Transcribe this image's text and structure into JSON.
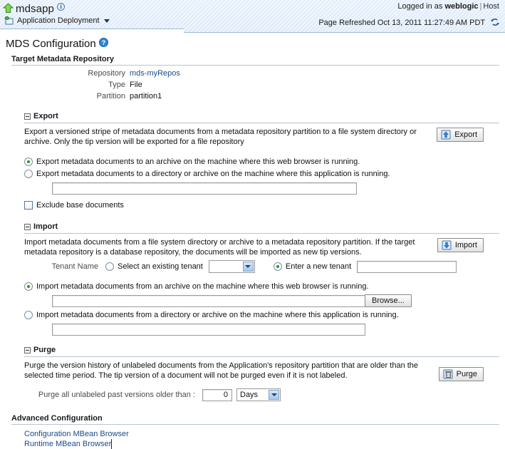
{
  "header": {
    "app_name": "mdsapp",
    "app_info_icon": "info-icon",
    "up_icon": "up-arrow-icon",
    "deployment_label": "Application Deployment",
    "deployment_icon": "application-deployment-icon",
    "dropdown_icon": "chevron-down-icon",
    "logged_in_prefix": "Logged in as",
    "user": "weblogic",
    "separator": "|",
    "host": "Host",
    "page_refreshed": "Page Refreshed Oct 13, 2011 11:27:49 AM PDT",
    "refresh_icon": "refresh-icon"
  },
  "page": {
    "title": "MDS Configuration",
    "help_icon": "help-icon"
  },
  "target_repository": {
    "heading": "Target Metadata Repository",
    "rows": [
      {
        "label": "Repository",
        "value": "mds-myRepos",
        "is_link": true
      },
      {
        "label": "Type",
        "value": "File",
        "is_link": false
      },
      {
        "label": "Partition",
        "value": "partition1",
        "is_link": false
      }
    ]
  },
  "export": {
    "heading": "Export",
    "twisty_icon": "collapse-icon",
    "description": "Export a versioned stripe of metadata documents from a metadata repository partition to a file system directory or archive. Only the tip version will be exported for a file repository",
    "button_label": "Export",
    "button_icon": "export-up-icon",
    "option_browser": "Export metadata documents to an archive on the machine where this web browser is running.",
    "option_server": "Export metadata documents to a directory or archive on the machine where this application is running.",
    "selected_option": "browser",
    "server_path_value": "",
    "exclude_base_label": "Exclude base documents",
    "exclude_base_checked": false
  },
  "import": {
    "heading": "Import",
    "twisty_icon": "collapse-icon",
    "description": "Import metadata documents from a file system directory or archive to a metadata repository partition. If the target metadata repository is a database repository, the documents will be imported as new tip versions.",
    "button_label": "Import",
    "button_icon": "import-down-icon",
    "tenant_label": "Tenant Name",
    "tenant_existing_label": "Select an existing tenant",
    "tenant_existing_value": "",
    "tenant_new_label": "Enter a new tenant",
    "tenant_new_value": "",
    "tenant_selected": "new",
    "option_browser": "Import metadata documents from an archive on the machine where this web browser is running.",
    "option_server": "Import metadata documents from a directory or archive on the machine where this application is running.",
    "selected_option": "browser",
    "browse_label": "Browse...",
    "browser_path_value": "",
    "server_path_value": ""
  },
  "purge": {
    "heading": "Purge",
    "twisty_icon": "collapse-icon",
    "description": "Purge the version history of unlabeled documents from the Application's repository partition that are older than the selected time period. The tip version of a document will not be purged even if it is not labeled.",
    "button_label": "Purge",
    "button_icon": "purge-trash-icon",
    "older_than_label": "Purge all unlabeled past versions older than :",
    "older_than_value": "0",
    "unit_value": "Days"
  },
  "advanced": {
    "heading": "Advanced Configuration",
    "links": [
      {
        "label": "Configuration MBean Browser"
      },
      {
        "label": "Runtime MBean Browser"
      }
    ]
  },
  "colors": {
    "header_bg": "#e0ecfa",
    "link": "#1a4b8c",
    "rule": "#b9c5d3",
    "radio_dot": "#1d9b1d"
  }
}
